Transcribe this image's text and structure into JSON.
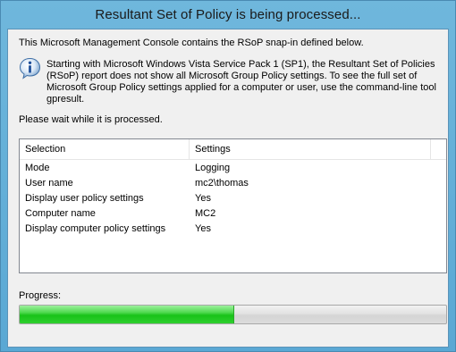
{
  "window": {
    "title": "Resultant Set of Policy is being processed..."
  },
  "dialog": {
    "intro": "This Microsoft Management Console contains the RSoP snap-in defined below.",
    "notice": "Starting with Microsoft Windows Vista Service Pack 1 (SP1), the Resultant Set of Policies (RSoP) report does not show all Microsoft Group Policy settings.  To see the full set of Microsoft Group Policy settings applied for a computer or user, use the command-line tool gpresult.",
    "wait_text": "Please wait while it is processed.",
    "info_icon": "info-icon"
  },
  "table": {
    "columns": [
      "Selection",
      "Settings"
    ],
    "rows": [
      {
        "selection": "Mode",
        "settings": "Logging"
      },
      {
        "selection": "User name",
        "settings": "mc2\\thomas"
      },
      {
        "selection": "Display user policy settings",
        "settings": "Yes"
      },
      {
        "selection": "Computer name",
        "settings": "MC2"
      },
      {
        "selection": "Display computer policy settings",
        "settings": "Yes"
      }
    ]
  },
  "progress": {
    "label": "Progress:",
    "fraction": 0.5,
    "color": "#22c622"
  }
}
